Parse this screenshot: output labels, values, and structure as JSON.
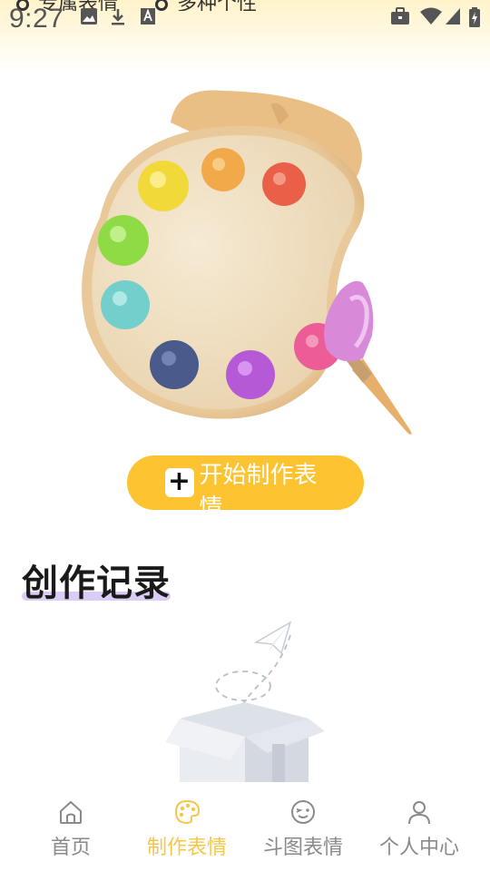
{
  "status_bar": {
    "time": "9:27",
    "left_icons": [
      "image-icon",
      "download-icon",
      "a-box-icon"
    ],
    "right_icons": [
      "briefcase-icon",
      "wifi-icon",
      "signal-icon",
      "battery-icon"
    ]
  },
  "header": {
    "items": [
      "专属表情",
      "多种个性"
    ]
  },
  "start_button": {
    "label": "开始制作表情",
    "icon": "plus-icon"
  },
  "section": {
    "title": "创作记录"
  },
  "bottom_nav": {
    "items": [
      {
        "label": "首页",
        "icon": "home-icon",
        "active": false
      },
      {
        "label": "制作表情",
        "icon": "palette-icon",
        "active": true
      },
      {
        "label": "斗图表情",
        "icon": "wink-face-icon",
        "active": false
      },
      {
        "label": "个人中心",
        "icon": "person-icon",
        "active": false
      }
    ]
  },
  "colors": {
    "accent": "#fdc330",
    "nav_active": "#f6c64a",
    "nav_inactive": "#8a8a8a",
    "underline": "#d9ccf5"
  }
}
